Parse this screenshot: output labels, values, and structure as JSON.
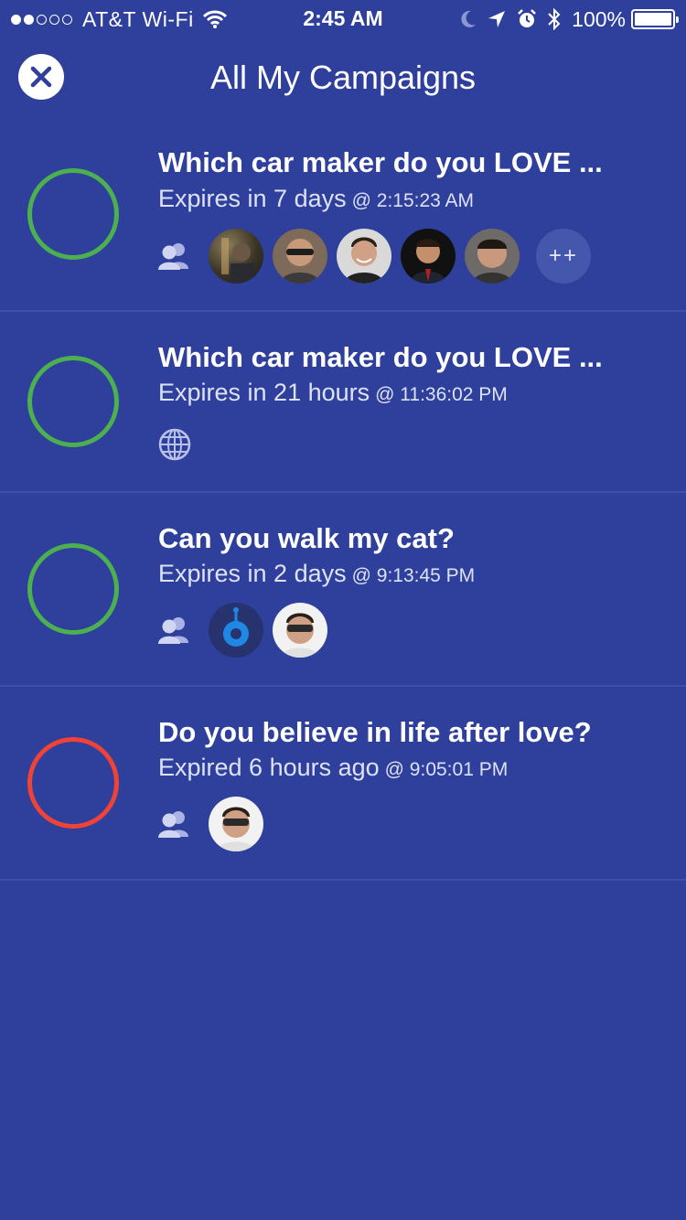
{
  "status_bar": {
    "carrier": "AT&T Wi-Fi",
    "time": "2:45 AM",
    "battery": "100%",
    "icons": [
      "signal-dots",
      "wifi-icon",
      "moon-icon",
      "location-arrow-icon",
      "alarm-clock-icon",
      "bluetooth-icon",
      "battery-icon"
    ]
  },
  "header": {
    "title": "All My Campaigns",
    "close_icon": "close-icon"
  },
  "campaigns": [
    {
      "title": "Which car maker do you LOVE ...",
      "expires": "Expires in 7 days",
      "at_time": "@ 2:15:23 AM",
      "status_color": "#4caf50",
      "audience_icon": "group-icon",
      "avatars": [
        "avatar-1",
        "avatar-2",
        "avatar-3",
        "avatar-4",
        "avatar-5"
      ],
      "more_label": "++"
    },
    {
      "title": "Which car maker do you LOVE ...",
      "expires": "Expires in 21 hours",
      "at_time": "@ 11:36:02 PM",
      "status_color": "#4caf50",
      "audience_icon": "globe-icon"
    },
    {
      "title": "Can you walk my cat?",
      "expires": "Expires in 2 days",
      "at_time": "@ 9:13:45 PM",
      "status_color": "#4caf50",
      "audience_icon": "group-icon",
      "avatars": [
        "app-logo-avatar",
        "avatar-sunglasses"
      ]
    },
    {
      "title": "Do you believe in life after love?",
      "expires": "Expired 6 hours ago",
      "at_time": "@ 9:05:01 PM",
      "status_color": "#ef4338",
      "audience_icon": "group-icon",
      "avatars": [
        "avatar-sunglasses"
      ]
    }
  ]
}
